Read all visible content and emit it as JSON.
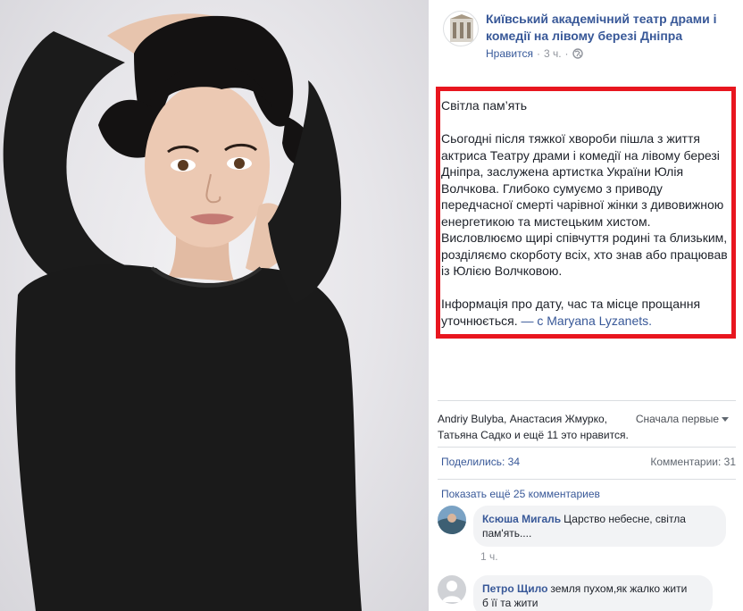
{
  "post": {
    "page_name": "Київський академічний театр драми і комедії на лівому березі Дніпра",
    "like_link": "Нравится",
    "separator": "·",
    "time": "3 ч.",
    "visibility_icon": "globe-icon",
    "paragraphs": [
      "Світла пам’ять",
      "Сьогодні після тяжкої хвороби пішла з життя актриса Театру драми і комедії на лівому березі Дніпра, заслужена артистка України Юлія Волчкова. Глибоко сумуємо з приводу передчасної смерті чарівної жінки з дивовижною енергетикою та мистецьким хистом. Висловлюємо щирі співчуття родині та близьким, розділяємо скорботу всіх, хто знав або працював із Юлією Волчковою.",
      "Інформація про дату, час та місце прощання уточнюється."
    ],
    "tag_prefix": " — с ",
    "tag_name": "Maryana Lyzanets."
  },
  "reactions": {
    "names": "Andriy Bulyba, Анастасия Жмурко, Татьяна Садко и ещё 11 это нравится.",
    "sort_label": "Сначала первые"
  },
  "stats": {
    "shares": "Поделились: 34",
    "comments": "Комментарии: 31"
  },
  "more_comments": "Показать ещё 25 комментариев",
  "comments": [
    {
      "author": "Ксюша Мигаль",
      "text_line1": "Царство небесне, світла",
      "text_line2": "пам'ять....",
      "time": "1 ч."
    },
    {
      "author": "Петро Щило",
      "text_line1": "земля пухом,як жалко жити",
      "text_line2": "б її та жити"
    }
  ],
  "colors": {
    "link": "#385898",
    "highlight_border": "#e8161f",
    "bubble_bg": "#f2f3f5",
    "sweater": "#1a1a1a",
    "hair": "#141212"
  }
}
